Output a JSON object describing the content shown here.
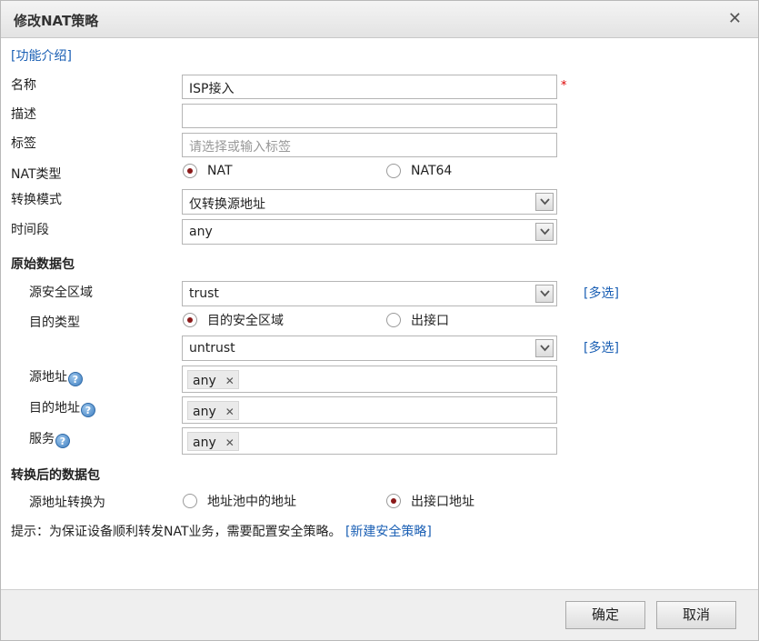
{
  "dialog": {
    "title": "修改NAT策略",
    "close_glyph": "✕",
    "intro_link": "[功能介绍]"
  },
  "form": {
    "name_label": "名称",
    "name_value": "ISP接入",
    "required_mark": "*",
    "desc_label": "描述",
    "desc_value": "",
    "tag_label": "标签",
    "tag_placeholder": "请选择或输入标签",
    "nat_type_label": "NAT类型",
    "nat_type_options": [
      "NAT",
      "NAT64"
    ],
    "nat_type_selected": "NAT",
    "convert_mode_label": "转换模式",
    "convert_mode_value": "仅转换源地址",
    "time_label": "时间段",
    "time_value": "any"
  },
  "original_packet": {
    "section_title": "原始数据包",
    "src_zone_label": "源安全区域",
    "src_zone_value": "trust",
    "multi_select_link": "[多选]",
    "dst_type_label": "目的类型",
    "dst_type_options": [
      "目的安全区域",
      "出接口"
    ],
    "dst_type_selected": "目的安全区域",
    "dst_zone_value": "untrust",
    "src_addr_label": "源地址",
    "src_addr_tag": "any",
    "dst_addr_label": "目的地址",
    "dst_addr_tag": "any",
    "service_label": "服务",
    "service_tag": "any",
    "tag_remove_glyph": "✕",
    "help_glyph": "?"
  },
  "translated_packet": {
    "section_title": "转换后的数据包",
    "src_convert_label": "源地址转换为",
    "src_convert_options": [
      "地址池中的地址",
      "出接口地址"
    ],
    "src_convert_selected": "出接口地址"
  },
  "hint": {
    "text": "提示：为保证设备顺利转发NAT业务，需要配置安全策略。",
    "link": "[新建安全策略]"
  },
  "footer": {
    "ok_label": "确定",
    "cancel_label": "取消"
  },
  "colors": {
    "link": "#1a5fb4",
    "radio_checked": "#8b1a1a",
    "required": "#dd0000"
  }
}
